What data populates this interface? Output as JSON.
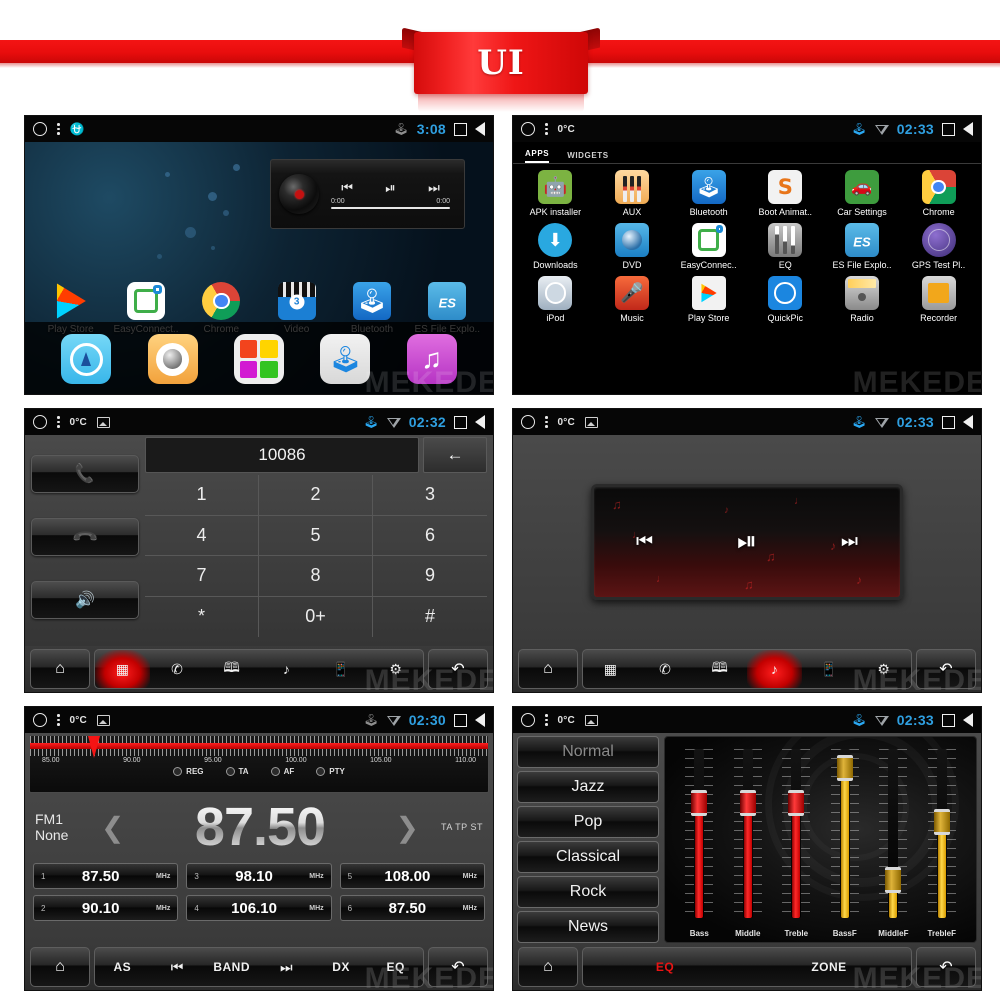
{
  "banner": {
    "title": "UI"
  },
  "watermark": "MEKEDE",
  "panels": {
    "home": {
      "status": {
        "temp": "",
        "time": "3:08",
        "bluetooth_icon": "bluetooth-icon",
        "usb_icon": "usb-icon"
      },
      "widget": {
        "prev_icon": "skip-previous-icon",
        "play_icon": "play-pause-icon",
        "next_icon": "skip-next-icon",
        "time_elapsed": "0:00",
        "time_total": "0:00"
      },
      "apps": [
        {
          "label": "Play Store",
          "icon": "play-store-icon"
        },
        {
          "label": "EasyConnect..",
          "icon": "easyconnect-icon"
        },
        {
          "label": "Chrome",
          "icon": "chrome-icon"
        },
        {
          "label": "Video",
          "icon": "video-icon",
          "badge": "3"
        },
        {
          "label": "Bluetooth",
          "icon": "bluetooth-icon"
        },
        {
          "label": "ES File Explo..",
          "icon": "es-file-explorer-icon"
        }
      ],
      "dock": [
        {
          "icon": "navigation-icon"
        },
        {
          "icon": "dvd-icon"
        },
        {
          "icon": "apps-grid-icon"
        },
        {
          "icon": "bluetooth-icon"
        },
        {
          "icon": "music-icon"
        }
      ]
    },
    "drawer": {
      "status": {
        "temp": "0°C",
        "time": "02:33"
      },
      "tabs": [
        {
          "label": "APPS",
          "active": true
        },
        {
          "label": "WIDGETS",
          "active": false
        }
      ],
      "apps": [
        {
          "label": "APK installer",
          "icon": "android-icon"
        },
        {
          "label": "AUX",
          "icon": "aux-cable-icon"
        },
        {
          "label": "Bluetooth",
          "icon": "bluetooth-icon"
        },
        {
          "label": "Boot Animat..",
          "icon": "boot-animation-icon"
        },
        {
          "label": "Car Settings",
          "icon": "car-settings-icon"
        },
        {
          "label": "Chrome",
          "icon": "chrome-icon"
        },
        {
          "label": "Downloads",
          "icon": "download-icon"
        },
        {
          "label": "DVD",
          "icon": "dvd-icon"
        },
        {
          "label": "EasyConnec..",
          "icon": "easyconnect-icon"
        },
        {
          "label": "EQ",
          "icon": "equalizer-icon"
        },
        {
          "label": "ES File Explo..",
          "icon": "es-file-explorer-icon"
        },
        {
          "label": "GPS Test Pl..",
          "icon": "gps-test-icon"
        },
        {
          "label": "iPod",
          "icon": "ipod-icon"
        },
        {
          "label": "Music",
          "icon": "microphone-icon"
        },
        {
          "label": "Play Store",
          "icon": "play-store-icon"
        },
        {
          "label": "QuickPic",
          "icon": "quickpic-icon"
        },
        {
          "label": "Radio",
          "icon": "radio-icon"
        },
        {
          "label": "Recorder",
          "icon": "recorder-icon"
        }
      ]
    },
    "dialer": {
      "status": {
        "temp": "0°C",
        "time": "02:32"
      },
      "number": "10086",
      "delete_icon": "backspace-arrow-icon",
      "side_buttons": [
        {
          "icon": "call-answer-icon"
        },
        {
          "icon": "call-end-icon"
        },
        {
          "icon": "speaker-icon"
        }
      ],
      "keys": [
        "1",
        "2",
        "3",
        "4",
        "5",
        "6",
        "7",
        "8",
        "9",
        "*",
        "0+",
        "#"
      ],
      "toolbar": [
        {
          "icon": "home-icon",
          "active": false
        },
        {
          "icon": "dialpad-icon",
          "active": true
        },
        {
          "icon": "call-log-icon",
          "active": false
        },
        {
          "icon": "contacts-book-icon",
          "active": false
        },
        {
          "icon": "bluetooth-music-icon",
          "active": false
        },
        {
          "icon": "phone-sync-icon",
          "active": false
        },
        {
          "icon": "settings-gear-icon",
          "active": false
        },
        {
          "icon": "back-arrow-icon",
          "active": false
        }
      ]
    },
    "player": {
      "status": {
        "temp": "0°C",
        "time": "02:33"
      },
      "controls": [
        {
          "icon": "skip-previous-icon",
          "glyph": "⏮"
        },
        {
          "icon": "play-pause-icon",
          "glyph": "⏯"
        },
        {
          "icon": "skip-next-icon",
          "glyph": "⏭"
        }
      ],
      "toolbar": [
        {
          "icon": "home-icon",
          "active": false
        },
        {
          "icon": "dialpad-icon",
          "active": false
        },
        {
          "icon": "call-log-icon",
          "active": false
        },
        {
          "icon": "contacts-book-icon",
          "active": false
        },
        {
          "icon": "bluetooth-music-icon",
          "active": true
        },
        {
          "icon": "phone-sync-icon",
          "active": false
        },
        {
          "icon": "settings-gear-icon",
          "active": false
        },
        {
          "icon": "back-arrow-icon",
          "active": false
        }
      ]
    },
    "radio": {
      "status": {
        "temp": "0°C",
        "time": "02:30"
      },
      "scale_labels": [
        "85.00",
        "90.00",
        "95.00",
        "100.00",
        "105.00",
        "110.00"
      ],
      "rds": [
        "REG",
        "TA",
        "AF",
        "PTY"
      ],
      "band": "FM1",
      "station_name": "None",
      "frequency": "87.50",
      "indicators": "TA TP ST",
      "prev_icon": "chevron-left-icon",
      "next_icon": "chevron-right-icon",
      "presets": [
        {
          "num": "1",
          "value": "87.50",
          "unit": "MHz"
        },
        {
          "num": "3",
          "value": "98.10",
          "unit": "MHz"
        },
        {
          "num": "5",
          "value": "108.00",
          "unit": "MHz"
        },
        {
          "num": "2",
          "value": "90.10",
          "unit": "MHz"
        },
        {
          "num": "4",
          "value": "106.10",
          "unit": "MHz"
        },
        {
          "num": "6",
          "value": "87.50",
          "unit": "MHz"
        }
      ],
      "toolbar": {
        "home_icon": "home-icon",
        "back_icon": "back-arrow-icon",
        "items": [
          {
            "label": "AS",
            "icon": ""
          },
          {
            "label": "",
            "icon": "seek-down-icon"
          },
          {
            "label": "BAND",
            "icon": ""
          },
          {
            "label": "",
            "icon": "seek-up-icon"
          },
          {
            "label": "DX",
            "icon": ""
          },
          {
            "label": "EQ",
            "icon": ""
          }
        ]
      }
    },
    "eq": {
      "status": {
        "temp": "0°C",
        "time": "02:33"
      },
      "presets": [
        {
          "label": "Normal",
          "selected": true
        },
        {
          "label": "Jazz",
          "selected": false
        },
        {
          "label": "Pop",
          "selected": false
        },
        {
          "label": "Classical",
          "selected": false
        },
        {
          "label": "Rock",
          "selected": false
        },
        {
          "label": "News",
          "selected": false
        }
      ],
      "sliders": [
        {
          "label": "Bass",
          "color": "red",
          "position_pct": 58
        },
        {
          "label": "Middle",
          "color": "red",
          "position_pct": 58
        },
        {
          "label": "Treble",
          "color": "red",
          "position_pct": 58
        },
        {
          "label": "BassF",
          "color": "yellow",
          "position_pct": 76
        },
        {
          "label": "MiddleF",
          "color": "yellow",
          "position_pct": 18
        },
        {
          "label": "TrebleF",
          "color": "yellow",
          "position_pct": 48
        }
      ],
      "toolbar": {
        "home_icon": "home-icon",
        "back_icon": "back-arrow-icon",
        "items": [
          {
            "label": "EQ",
            "active": true
          },
          {
            "label": "ZONE",
            "active": false
          }
        ]
      }
    }
  },
  "colors": {
    "accent_red": "#e81414",
    "banner_red": "#e80d0d",
    "status_blue": "#2f9fe0",
    "bluetooth_blue": "#2aa8f2"
  }
}
